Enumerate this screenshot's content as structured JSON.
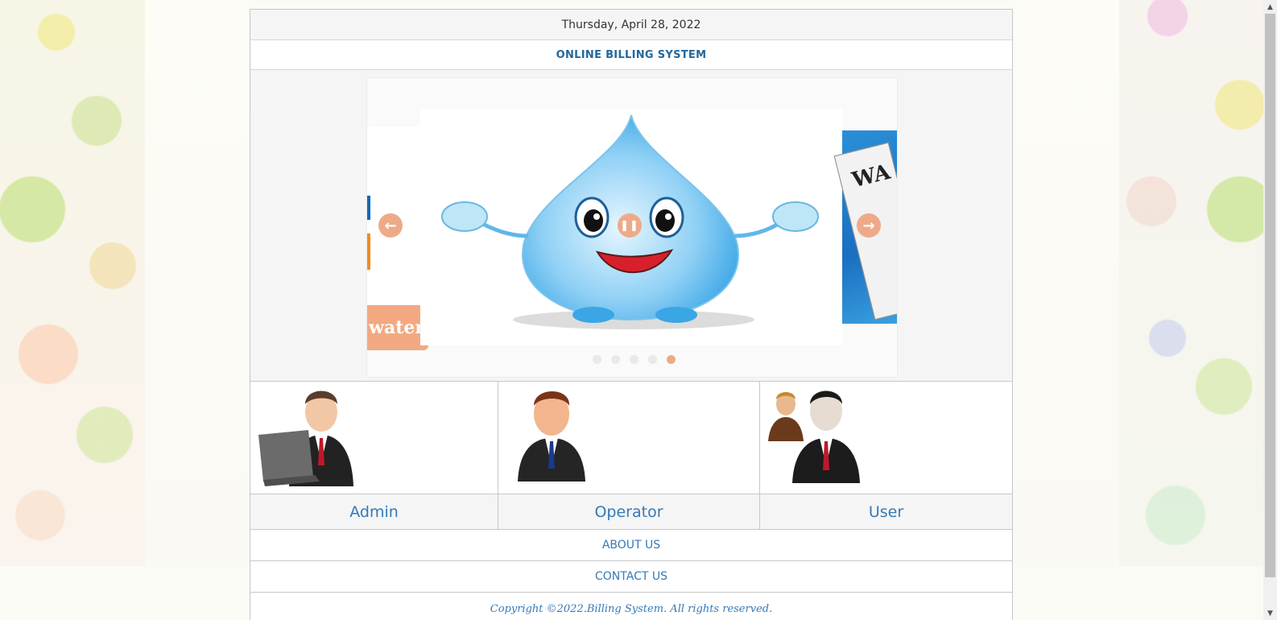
{
  "header": {
    "date": "Thursday, April 28, 2022",
    "title": "ONLINE BILLING SYSTEM"
  },
  "slider": {
    "badge_text": "water",
    "newspaper_text": "WA",
    "prev_icon": "arrow-left-icon",
    "next_icon": "arrow-right-icon",
    "pause_icon": "pause-icon",
    "dot_count": 5,
    "active_dot": 5
  },
  "roles": [
    {
      "label": "Admin",
      "icon": "admin-with-laptop-icon"
    },
    {
      "label": "Operator",
      "icon": "operator-businessman-icon"
    },
    {
      "label": "User",
      "icon": "user-group-icon"
    }
  ],
  "links": {
    "about": "ABOUT US",
    "contact": "CONTACT US"
  },
  "footer": {
    "copyright": "Copyright ©2022.Billing System. All rights reserved."
  },
  "colors": {
    "link_blue": "#3579b8",
    "title_blue": "#23679c",
    "accent_peach": "#eeaa88"
  }
}
